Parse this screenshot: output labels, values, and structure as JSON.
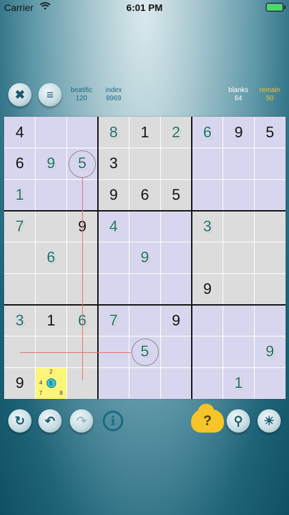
{
  "status_bar": {
    "carrier": "Carrier",
    "time": "6:01 PM"
  },
  "header": {
    "close_icon": "✖",
    "menu_icon": "≡",
    "stats": [
      {
        "label": "beatific",
        "value": "120"
      },
      {
        "label": "index",
        "value": "8969"
      },
      {
        "label": "blanks",
        "value": "64"
      },
      {
        "label": "remain",
        "value": "50"
      }
    ]
  },
  "board": {
    "rows": [
      [
        "4",
        "",
        "",
        "8",
        "1",
        "2",
        "6",
        "9",
        "5"
      ],
      [
        "6",
        "9",
        "5",
        "3",
        "",
        "",
        "",
        "",
        ""
      ],
      [
        "1",
        "",
        "",
        "9",
        "6",
        "5",
        "",
        "",
        ""
      ],
      [
        "7",
        "",
        "9",
        "4",
        "",
        "",
        "3",
        "",
        ""
      ],
      [
        "",
        "6",
        "",
        "",
        "9",
        "",
        "",
        "",
        ""
      ],
      [
        "",
        "",
        "",
        "",
        "",
        "",
        "9",
        "",
        ""
      ],
      [
        "3",
        "1",
        "6",
        "7",
        "",
        "9",
        "",
        "",
        ""
      ],
      [
        "",
        "",
        "",
        "",
        "5",
        "",
        "",
        "",
        "9"
      ],
      [
        "9",
        "",
        "",
        "",
        "",
        "",
        "",
        "1",
        ""
      ]
    ],
    "entered": [
      [
        0,
        3
      ],
      [
        0,
        5
      ],
      [
        0,
        6
      ],
      [
        1,
        1
      ],
      [
        1,
        2
      ],
      [
        2,
        0
      ],
      [
        3,
        0
      ],
      [
        3,
        3
      ],
      [
        3,
        6
      ],
      [
        4,
        1
      ],
      [
        4,
        4
      ],
      [
        6,
        0
      ],
      [
        6,
        2
      ],
      [
        6,
        3
      ],
      [
        7,
        4
      ],
      [
        7,
        8
      ],
      [
        8,
        7
      ]
    ],
    "selected_pencil": {
      "top": "2",
      "left": "4",
      "center": "5",
      "bottom_left": "7",
      "bottom_right": "8"
    }
  },
  "toolbar": {
    "refresh_icon": "↻",
    "undo_icon": "↶",
    "redo_icon": "↷",
    "info_icon": "i",
    "help_label": "?",
    "search_icon": "⚲",
    "brightness_icon": "☀"
  }
}
